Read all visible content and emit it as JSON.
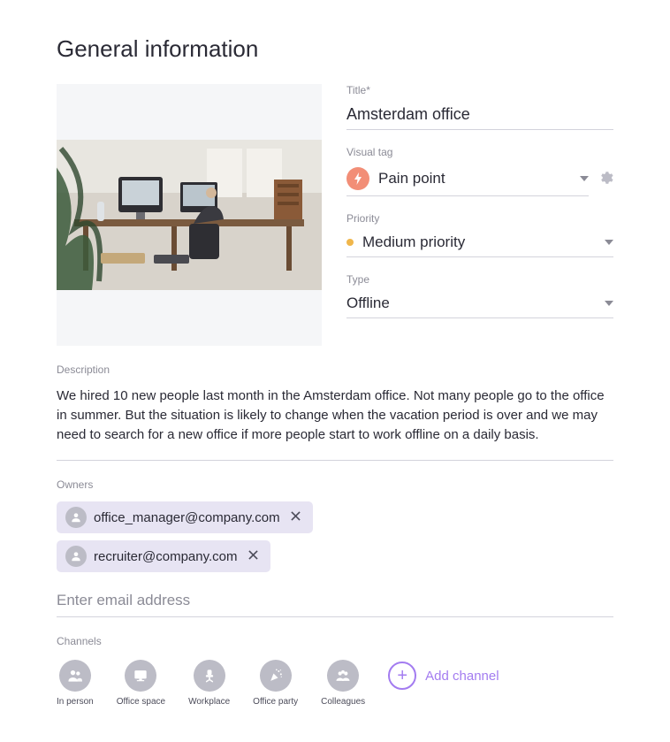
{
  "heading": "General information",
  "fields": {
    "title": {
      "label": "Title*",
      "value": "Amsterdam office"
    },
    "visual_tag": {
      "label": "Visual tag",
      "value": "Pain point"
    },
    "priority": {
      "label": "Priority",
      "value": "Medium priority"
    },
    "type": {
      "label": "Type",
      "value": "Offline"
    }
  },
  "description": {
    "label": "Description",
    "text": "We hired 10 new people last month in the Amsterdam office. Not many people go to the office in summer. But the situation is likely to change when the vacation period is over and we may need to search for a new office if more people start to work offline on a daily basis."
  },
  "owners": {
    "label": "Owners",
    "list": [
      {
        "email": "office_manager@company.com"
      },
      {
        "email": "recruiter@company.com"
      }
    ],
    "placeholder": "Enter email address"
  },
  "channels": {
    "label": "Channels",
    "items": [
      {
        "label": "In person"
      },
      {
        "label": "Office space"
      },
      {
        "label": "Workplace"
      },
      {
        "label": "Office party"
      },
      {
        "label": "Colleagues"
      }
    ],
    "add_label": "Add channel"
  }
}
